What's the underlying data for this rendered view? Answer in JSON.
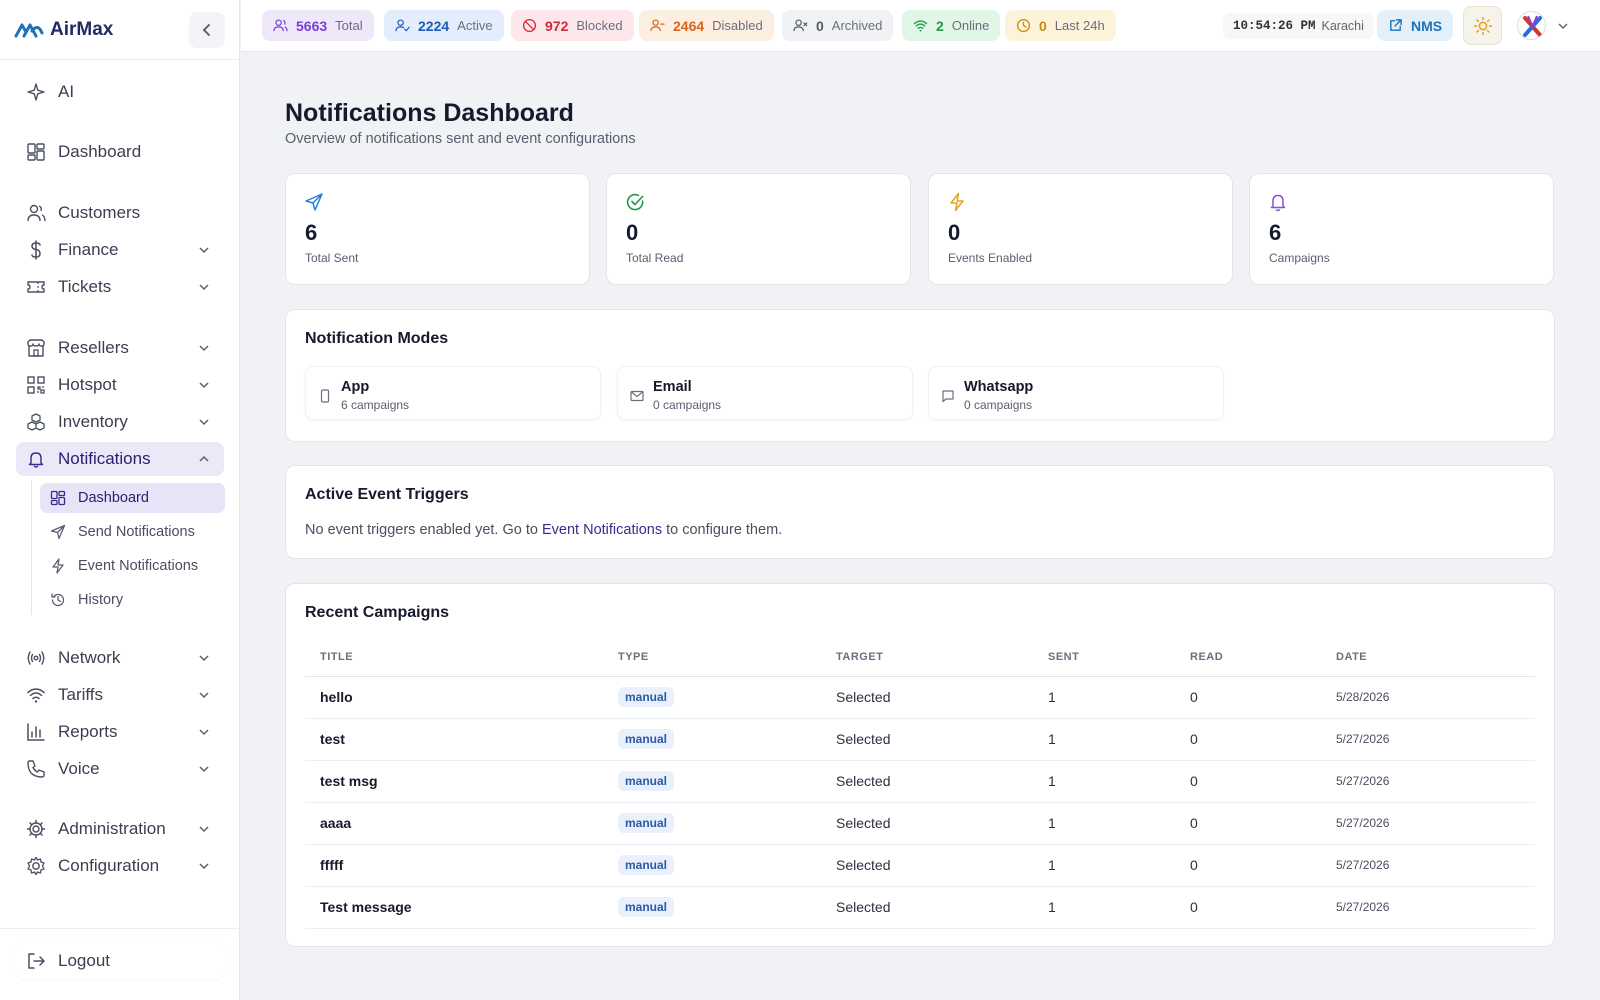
{
  "brand": {
    "name": "AirMax"
  },
  "sidebar": {
    "items": [
      {
        "label": "AI",
        "icon": "sparkles-icon"
      },
      {
        "label": "Dashboard",
        "icon": "dashboard-icon"
      },
      {
        "label": "Customers",
        "icon": "users-icon"
      },
      {
        "label": "Finance",
        "icon": "dollar-icon"
      },
      {
        "label": "Tickets",
        "icon": "ticket-icon"
      },
      {
        "label": "Resellers",
        "icon": "store-icon"
      },
      {
        "label": "Hotspot",
        "icon": "qr-icon"
      },
      {
        "label": "Inventory",
        "icon": "boxes-icon"
      },
      {
        "label": "Notifications",
        "icon": "bell-icon"
      },
      {
        "label": "Network",
        "icon": "broadcast-icon"
      },
      {
        "label": "Tariffs",
        "icon": "wifi-icon"
      },
      {
        "label": "Reports",
        "icon": "bar-chart-icon"
      },
      {
        "label": "Voice",
        "icon": "phone-icon"
      },
      {
        "label": "Administration",
        "icon": "gear-icon"
      },
      {
        "label": "Configuration",
        "icon": "cog-icon"
      }
    ],
    "sub_items": [
      {
        "label": "Dashboard",
        "icon": "dashboard-icon"
      },
      {
        "label": "Send Notifications",
        "icon": "send-icon"
      },
      {
        "label": "Event Notifications",
        "icon": "bolt-icon"
      },
      {
        "label": "History",
        "icon": "history-icon"
      }
    ],
    "logout": "Logout"
  },
  "topbar": {
    "chips": [
      {
        "value": "5663",
        "label": "Total",
        "color": "#7a3fd1",
        "bg": "#efe8fb"
      },
      {
        "value": "2224",
        "label": "Active",
        "color": "#1e5bb8",
        "bg": "#e3edfb"
      },
      {
        "value": "972",
        "label": "Blocked",
        "color": "#d12a3a",
        "bg": "#fce8ea"
      },
      {
        "value": "2464",
        "label": "Disabled",
        "color": "#d9641a",
        "bg": "#fdeee2"
      },
      {
        "value": "0",
        "label": "Archived",
        "color": "#555a68",
        "bg": "#f1f2f5"
      },
      {
        "value": "2",
        "label": "Online",
        "color": "#1d9a4a",
        "bg": "#e2f6e8"
      },
      {
        "value": "0",
        "label": "Last 24h",
        "color": "#c88a0a",
        "bg": "#fdf3da"
      }
    ],
    "clock_time": "10:54:26 PM",
    "clock_zone": "Karachi",
    "nms_label": "NMS"
  },
  "page": {
    "title": "Notifications Dashboard",
    "subtitle": "Overview of notifications sent and event configurations"
  },
  "stats": [
    {
      "value": "6",
      "label": "Total Sent",
      "icon": "send-icon",
      "color": "#2a7fd4"
    },
    {
      "value": "0",
      "label": "Total Read",
      "icon": "check-circle-icon",
      "color": "#1d9a4a"
    },
    {
      "value": "0",
      "label": "Events Enabled",
      "icon": "bolt-icon",
      "color": "#e6a31a"
    },
    {
      "value": "6",
      "label": "Campaigns",
      "icon": "bell-icon",
      "color": "#8a4fd8"
    }
  ],
  "modes": {
    "title": "Notification Modes",
    "items": [
      {
        "name": "App",
        "count": "6 campaigns",
        "icon": "phone-device-icon"
      },
      {
        "name": "Email",
        "count": "0 campaigns",
        "icon": "mail-icon"
      },
      {
        "name": "Whatsapp",
        "count": "0 campaigns",
        "icon": "chat-icon"
      }
    ]
  },
  "triggers": {
    "title": "Active Event Triggers",
    "text_before": "No event triggers enabled yet. Go to ",
    "link": "Event Notifications",
    "text_after": " to configure them."
  },
  "campaigns": {
    "title": "Recent Campaigns",
    "columns": [
      "TITLE",
      "TYPE",
      "TARGET",
      "SENT",
      "READ",
      "DATE"
    ],
    "rows": [
      {
        "title": "hello",
        "type": "manual",
        "target": "Selected",
        "sent": "1",
        "read": "0",
        "date": "5/28/2026"
      },
      {
        "title": "test",
        "type": "manual",
        "target": "Selected",
        "sent": "1",
        "read": "0",
        "date": "5/27/2026"
      },
      {
        "title": "test msg",
        "type": "manual",
        "target": "Selected",
        "sent": "1",
        "read": "0",
        "date": "5/27/2026"
      },
      {
        "title": "aaaa",
        "type": "manual",
        "target": "Selected",
        "sent": "1",
        "read": "0",
        "date": "5/27/2026"
      },
      {
        "title": "fffff",
        "type": "manual",
        "target": "Selected",
        "sent": "1",
        "read": "0",
        "date": "5/27/2026"
      },
      {
        "title": "Test message",
        "type": "manual",
        "target": "Selected",
        "sent": "1",
        "read": "0",
        "date": "5/27/2026"
      }
    ]
  }
}
